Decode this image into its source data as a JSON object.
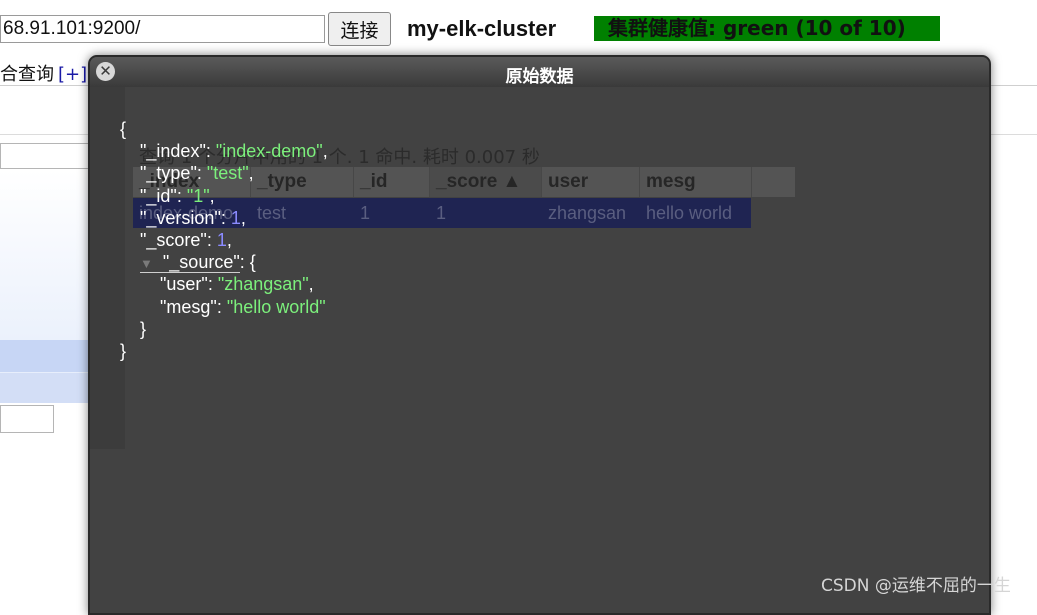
{
  "header": {
    "url_value": "68.91.101:9200/",
    "connect_label": "连接",
    "cluster_name": "my-elk-cluster",
    "health_text": "集群健康值: green (10 of 10)"
  },
  "tabs": {
    "query_label": "合查询",
    "add_label": "[+]"
  },
  "background_results": {
    "summary": "查询 1 个分片中用的 1 个. 1 命中. 耗时 0.007 秒",
    "columns": [
      "_index",
      "_type",
      "_id",
      "_score ▲",
      "user",
      "mesg"
    ],
    "row": [
      "index-demo",
      "test",
      "1",
      "1",
      "zhangsan",
      "hello world"
    ]
  },
  "modal": {
    "title": "原始数据",
    "close_icon": "close-icon"
  },
  "json_doc": {
    "index_key": "\"_index\"",
    "index_val": "\"index-demo\"",
    "type_key": "\"_type\"",
    "type_val": "\"test\"",
    "id_key": "\"_id\"",
    "id_val": "\"1\"",
    "version_key": "\"_version\"",
    "version_val": "1",
    "score_key": "\"_score\"",
    "score_val": "1",
    "source_key": "\"_source\"",
    "user_key": "\"user\"",
    "user_val": "\"zhangsan\"",
    "mesg_key": "\"mesg\"",
    "mesg_val": "\"hello world\""
  },
  "watermark": "CSDN @运维不屈的一生",
  "colors": {
    "health_green": "#008000",
    "modal_bg": "#424242",
    "json_string": "#7cf07c",
    "json_number": "#8b8bff"
  }
}
